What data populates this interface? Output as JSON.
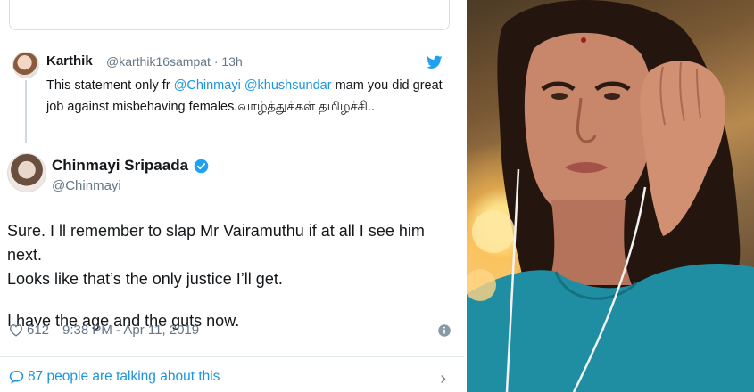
{
  "reply": {
    "name": "Karthik",
    "handle": "@karthik16sampat · 13h",
    "text_before": "This statement only fr ",
    "mention1": "@Chinmayi",
    "mention2": "@khushsundar",
    "text_after": " mam you did great job against misbehaving females.வாழ்த்துக்கள் தமிழச்சி.."
  },
  "tweet": {
    "author_name": "Chinmayi Sripaada",
    "author_handle": "@Chinmayi",
    "line1": "Sure. I ll remember to slap Mr Vairamuthu if at all I see him next.",
    "line2": "Looks like that’s the only justice I’ll get.",
    "line3": "I have the age and the guts now.",
    "likes": "612",
    "timestamp": "9:38 PM - Apr 11, 2019"
  },
  "footer": {
    "talking": "87 people are talking about this"
  },
  "colors": {
    "twitter_blue": "#1b95e0",
    "text": "#14171a",
    "muted": "#657786"
  },
  "icons": [
    "twitter-bird-icon",
    "verified-icon",
    "heart-icon",
    "info-icon",
    "speech-bubble-icon",
    "chevron-right-icon"
  ]
}
